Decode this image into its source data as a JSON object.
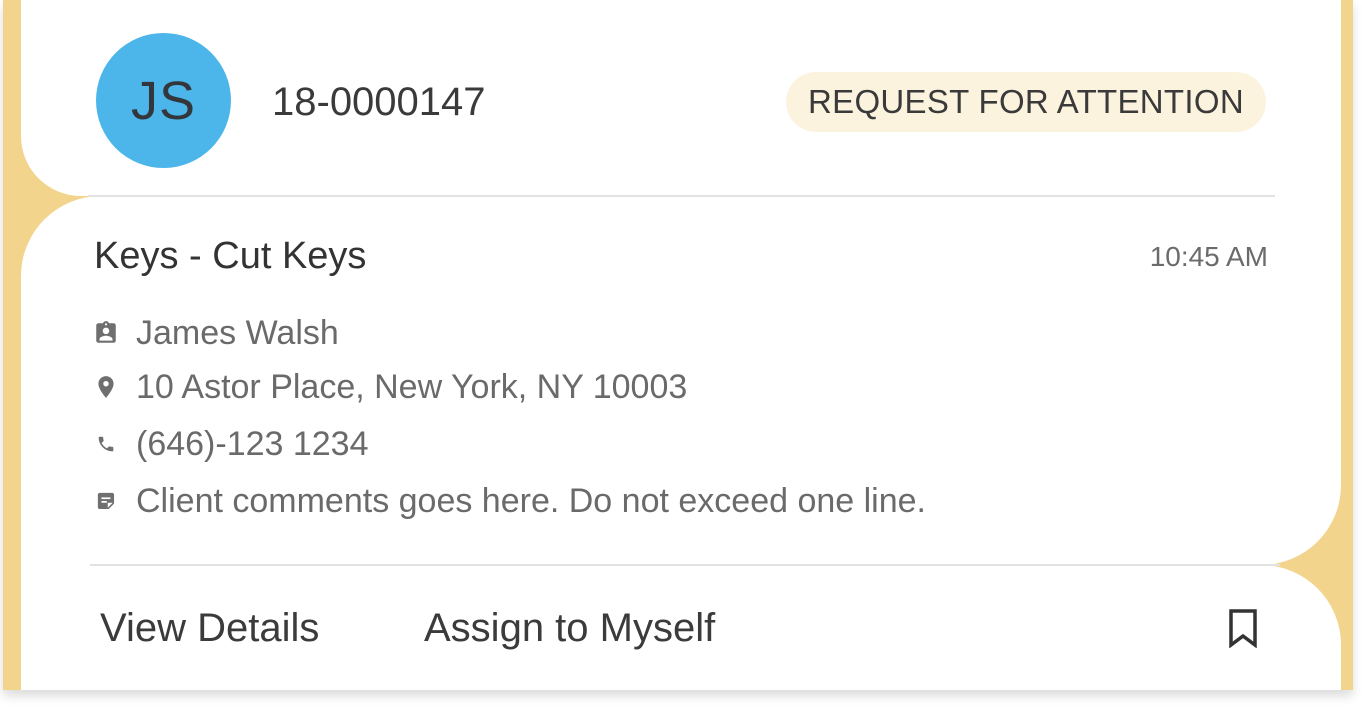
{
  "card": {
    "avatar_initials": "JS",
    "ticket_id": "18-0000147",
    "status_badge": "REQUEST FOR ATTENTION",
    "service_title": "Keys - Cut Keys",
    "time": "10:45 AM",
    "client_name": "James Walsh",
    "address": "10 Astor Place, New York, NY 10003",
    "phone": "(646)-123 1234",
    "comment": "Client comments goes here. Do not exceed one line."
  },
  "actions": {
    "view_details": "View Details",
    "assign": "Assign to Myself"
  },
  "icons": {
    "client": "assignment-ind-icon",
    "address": "location-pin-icon",
    "phone": "phone-icon",
    "comment": "note-icon",
    "bookmark": "bookmark-outline-icon"
  },
  "colors": {
    "frame_accent": "#f2d48d",
    "avatar_bg": "#4cb5ea",
    "badge_bg": "#fcf3df"
  }
}
